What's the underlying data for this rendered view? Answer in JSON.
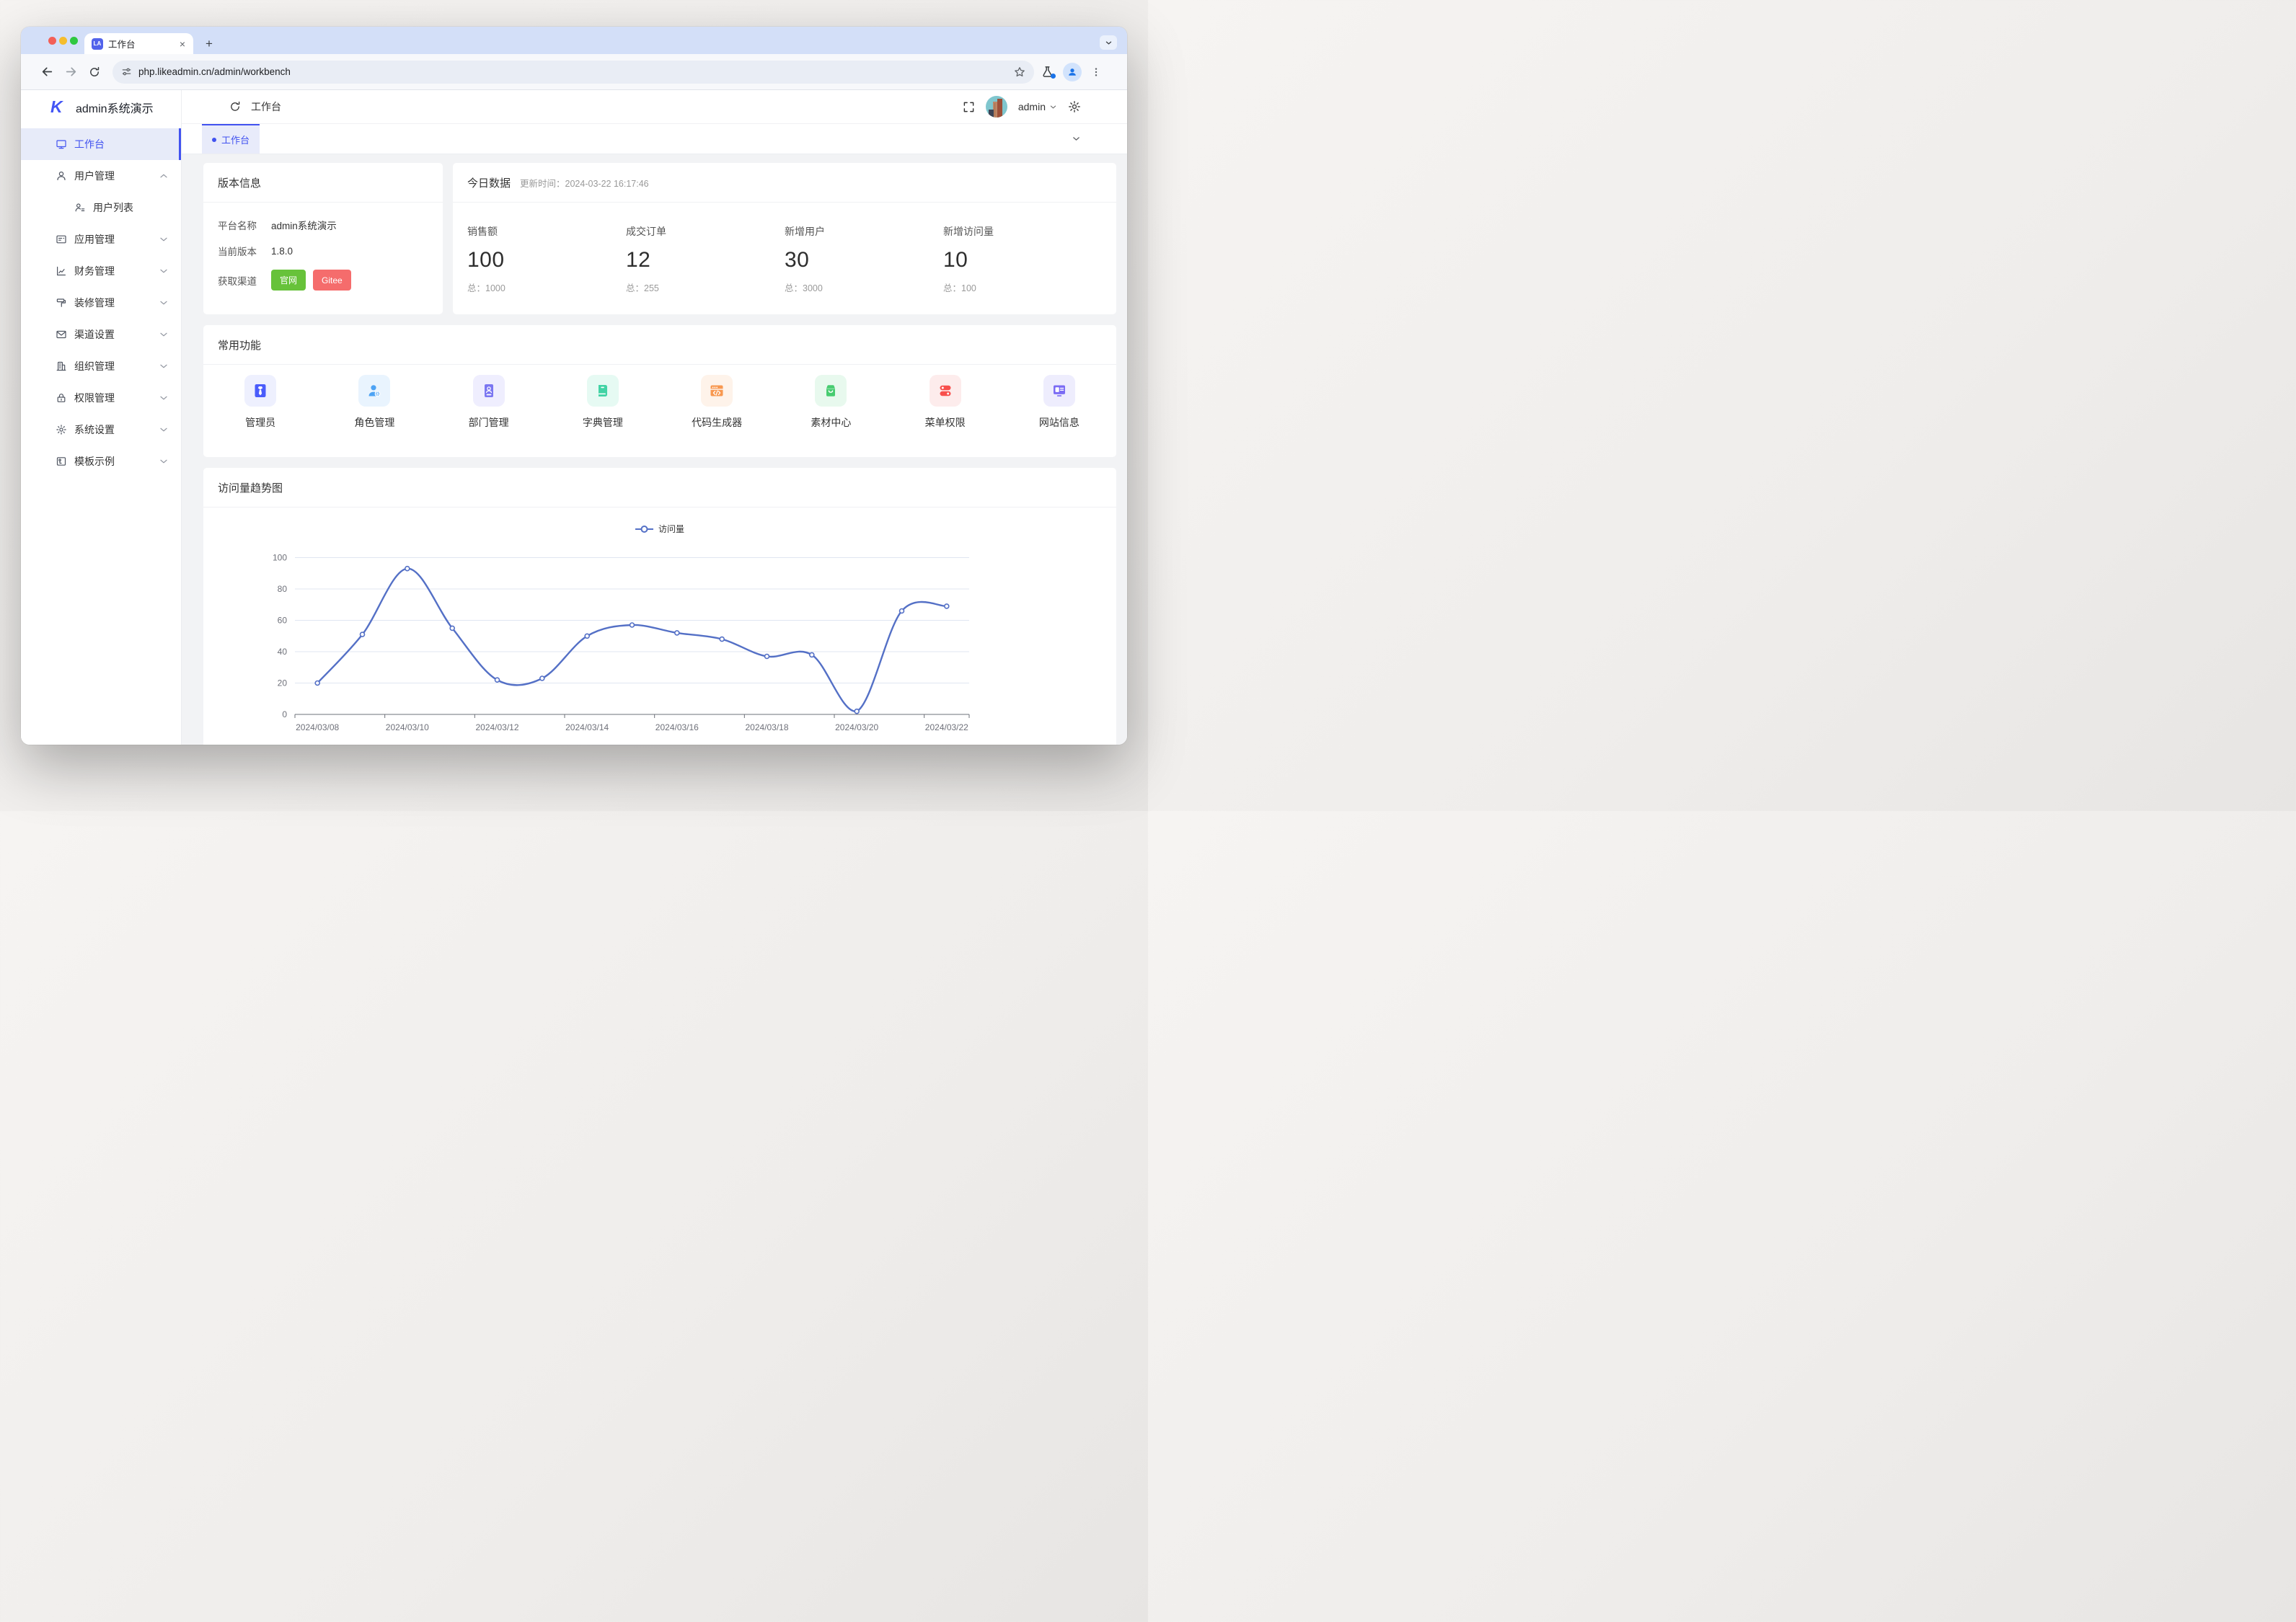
{
  "browser": {
    "tab": {
      "favicon_text": "LA",
      "title": "工作台"
    },
    "url": "php.likeadmin.cn/admin/workbench"
  },
  "app": {
    "brand": {
      "title": "admin系统演示"
    },
    "header": {
      "breadcrumb": "工作台",
      "username": "admin"
    },
    "page_tab": {
      "label": "工作台"
    },
    "theme_color": "#4152f0",
    "sidebar": {
      "items": [
        {
          "icon": "monitor-icon",
          "label": "工作台",
          "active": true
        },
        {
          "icon": "user-icon",
          "label": "用户管理",
          "expanded": true,
          "children": [
            {
              "icon": "user-list-icon",
              "label": "用户列表"
            }
          ]
        },
        {
          "icon": "app-icon",
          "label": "应用管理"
        },
        {
          "icon": "finance-icon",
          "label": "财务管理"
        },
        {
          "icon": "decorate-icon",
          "label": "装修管理"
        },
        {
          "icon": "channel-icon",
          "label": "渠道设置"
        },
        {
          "icon": "org-icon",
          "label": "组织管理"
        },
        {
          "icon": "lock-icon",
          "label": "权限管理"
        },
        {
          "icon": "gear-icon",
          "label": "系统设置"
        },
        {
          "icon": "template-icon",
          "label": "模板示例"
        }
      ]
    },
    "version_card": {
      "title": "版本信息",
      "rows": [
        {
          "label": "平台名称",
          "value": "admin系统演示"
        },
        {
          "label": "当前版本",
          "value": "1.8.0"
        }
      ],
      "channel_label": "获取渠道",
      "buttons": [
        {
          "label": "官网",
          "color": "#67c23a"
        },
        {
          "label": "Gitee",
          "color": "#f56c6c"
        }
      ]
    },
    "today_card": {
      "title": "今日数据",
      "update_label": "更新时间：",
      "update_time": "2024-03-22 16:17:46",
      "stats": [
        {
          "label": "销售额",
          "value": "100",
          "total": "总：1000"
        },
        {
          "label": "成交订单",
          "value": "12",
          "total": "总：255"
        },
        {
          "label": "新增用户",
          "value": "30",
          "total": "总：3000"
        },
        {
          "label": "新增访问量",
          "value": "10",
          "total": "总：100"
        }
      ]
    },
    "functions_card": {
      "title": "常用功能",
      "items": [
        {
          "label": "管理员",
          "icon": "admin-tie-icon",
          "bg": "#eef0fe",
          "color": "#4a5cfb"
        },
        {
          "label": "角色管理",
          "icon": "role-user-gear-icon",
          "bg": "#e9f4fe",
          "color": "#4da3f4"
        },
        {
          "label": "部门管理",
          "icon": "department-card-icon",
          "bg": "#efeefe",
          "color": "#7b77f1"
        },
        {
          "label": "字典管理",
          "icon": "dictionary-book-icon",
          "bg": "#e6faf3",
          "color": "#42d3a5"
        },
        {
          "label": "代码生成器",
          "icon": "code-generator-icon",
          "bg": "#fef3ea",
          "color": "#f89850"
        },
        {
          "label": "素材中心",
          "icon": "material-center-icon",
          "bg": "#e8f9ee",
          "color": "#47cc70"
        },
        {
          "label": "菜单权限",
          "icon": "menu-permission-icon",
          "bg": "#fdecec",
          "color": "#f8504d"
        },
        {
          "label": "网站信息",
          "icon": "site-info-icon",
          "bg": "#eeedfd",
          "color": "#7b6cf4"
        }
      ]
    },
    "chart_card": {
      "title": "访问量趋势图",
      "legend": "访问量"
    }
  },
  "chart_data": {
    "type": "line",
    "title": "访问量趋势图",
    "legend": [
      "访问量"
    ],
    "legend_position": "top-center",
    "smooth": true,
    "grid": true,
    "line_color": "#5470c6",
    "axis_label_color": "#6E7079",
    "grid_color": "#E0E6F1",
    "ylim": [
      0,
      100
    ],
    "y_ticks": [
      0,
      20,
      40,
      60,
      80,
      100
    ],
    "x": [
      "2024/03/08",
      "2024/03/09",
      "2024/03/10",
      "2024/03/11",
      "2024/03/12",
      "2024/03/13",
      "2024/03/14",
      "2024/03/15",
      "2024/03/16",
      "2024/03/17",
      "2024/03/18",
      "2024/03/19",
      "2024/03/20",
      "2024/03/21",
      "2024/03/22"
    ],
    "x_tick_labels": [
      "2024/03/08",
      "2024/03/10",
      "2024/03/12",
      "2024/03/14",
      "2024/03/16",
      "2024/03/18",
      "2024/03/20",
      "2024/03/22"
    ],
    "values": [
      20,
      51,
      93,
      55,
      22,
      23,
      50,
      57,
      52,
      48,
      37,
      38,
      2,
      66,
      69
    ]
  }
}
